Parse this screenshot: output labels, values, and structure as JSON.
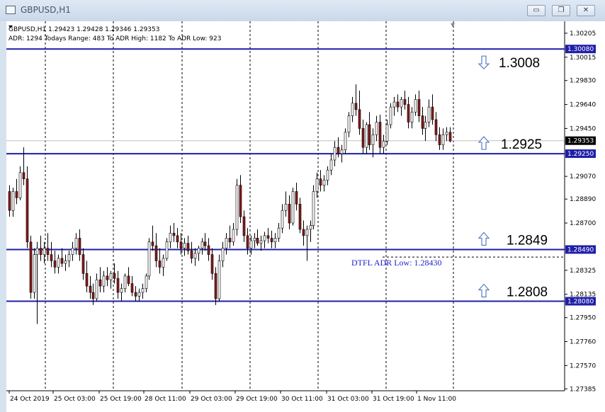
{
  "window": {
    "title": "GBPUSD,H1",
    "minimize_glyph": "▭",
    "restore_glyph": "❐",
    "close_glyph": "✕"
  },
  "chart_data": {
    "type": "candlestick",
    "symbol_line": "GBPUSD,H1  1.29423 1.29428 1.29346 1.29353",
    "info_line": "ADR: 1294  Todays Range: 483   To ADR High: 1182   To ADR Low: 923",
    "current_price": "1.29353",
    "ylim": [
      1.2737,
      1.303
    ],
    "y_ticks": [
      "1.30205",
      "1.30015",
      "1.29830",
      "1.29640",
      "1.29450",
      "1.29070",
      "1.28890",
      "1.28700",
      "1.28325",
      "1.28135",
      "1.27950",
      "1.27760",
      "1.27570",
      "1.27385"
    ],
    "x_labels": [
      "24 Oct 2019",
      "25 Oct 03:00",
      "25 Oct 19:00",
      "28 Oct 11:00",
      "29 Oct 03:00",
      "29 Oct 19:00",
      "30 Oct 11:00",
      "31 Oct 03:00",
      "31 Oct 19:00",
      "1 Nov 11:00"
    ],
    "levels": [
      {
        "price": 1.3008,
        "tag": "1.30080",
        "label": "1.3008",
        "arrow": "down"
      },
      {
        "price": 1.2925,
        "tag": "1.29250",
        "label": "1.2925",
        "arrow": "up"
      },
      {
        "price": 1.2849,
        "tag": "1.28490",
        "label": "1.2849",
        "arrow": "up"
      },
      {
        "price": 1.2808,
        "tag": "1.28080",
        "label": "1.2808",
        "arrow": "up"
      }
    ],
    "adr_low": {
      "price": 1.2843,
      "text": "DTFL ADR Low: 1.28430"
    },
    "candles": [
      [
        1.2895,
        1.29,
        1.2875,
        1.288
      ],
      [
        1.288,
        1.2898,
        1.2875,
        1.2895
      ],
      [
        1.2895,
        1.2905,
        1.2885,
        1.289
      ],
      [
        1.289,
        1.2915,
        1.2888,
        1.291
      ],
      [
        1.291,
        1.293,
        1.29,
        1.2905
      ],
      [
        1.2905,
        1.2915,
        1.285,
        1.2855
      ],
      [
        1.2855,
        1.286,
        1.281,
        1.2815
      ],
      [
        1.2815,
        1.285,
        1.281,
        1.2845
      ],
      [
        1.2845,
        1.2855,
        1.279,
        1.285
      ],
      [
        1.285,
        1.286,
        1.284,
        1.2845
      ],
      [
        1.2845,
        1.2855,
        1.2838,
        1.285
      ],
      [
        1.285,
        1.2862,
        1.284,
        1.2845
      ],
      [
        1.2845,
        1.2855,
        1.2835,
        1.284
      ],
      [
        1.284,
        1.2848,
        1.283,
        1.2835
      ],
      [
        1.2835,
        1.2845,
        1.283,
        1.2842
      ],
      [
        1.2842,
        1.285,
        1.2835,
        1.2838
      ],
      [
        1.2838,
        1.2845,
        1.2832,
        1.284
      ],
      [
        1.284,
        1.2848,
        1.2835,
        1.2845
      ],
      [
        1.2845,
        1.2855,
        1.284,
        1.285
      ],
      [
        1.285,
        1.2862,
        1.2845,
        1.2858
      ],
      [
        1.2858,
        1.2865,
        1.284,
        1.2845
      ],
      [
        1.2845,
        1.285,
        1.2825,
        1.283
      ],
      [
        1.283,
        1.284,
        1.2815,
        1.282
      ],
      [
        1.282,
        1.2828,
        1.281,
        1.2815
      ],
      [
        1.2815,
        1.2822,
        1.2805,
        1.281
      ],
      [
        1.281,
        1.283,
        1.2808,
        1.2825
      ],
      [
        1.2825,
        1.2835,
        1.2815,
        1.282
      ],
      [
        1.282,
        1.2832,
        1.2815,
        1.2828
      ],
      [
        1.2828,
        1.2835,
        1.282,
        1.2825
      ],
      [
        1.2825,
        1.2832,
        1.2818,
        1.283
      ],
      [
        1.283,
        1.2838,
        1.2822,
        1.2826
      ],
      [
        1.2826,
        1.2832,
        1.281,
        1.2815
      ],
      [
        1.2815,
        1.2822,
        1.2808,
        1.2818
      ],
      [
        1.2818,
        1.283,
        1.2815,
        1.2828
      ],
      [
        1.2828,
        1.2835,
        1.282,
        1.2822
      ],
      [
        1.2822,
        1.2828,
        1.2812,
        1.2815
      ],
      [
        1.2815,
        1.282,
        1.2808,
        1.2812
      ],
      [
        1.2812,
        1.2818,
        1.2808,
        1.2815
      ],
      [
        1.2815,
        1.2822,
        1.281,
        1.2818
      ],
      [
        1.2818,
        1.283,
        1.2815,
        1.2828
      ],
      [
        1.2828,
        1.2858,
        1.2825,
        1.2855
      ],
      [
        1.2855,
        1.2868,
        1.2848,
        1.2852
      ],
      [
        1.2852,
        1.2862,
        1.2835,
        1.284
      ],
      [
        1.284,
        1.285,
        1.283,
        1.2835
      ],
      [
        1.2835,
        1.2845,
        1.2828,
        1.2842
      ],
      [
        1.2842,
        1.2858,
        1.284,
        1.2855
      ],
      [
        1.2855,
        1.2868,
        1.285,
        1.2862
      ],
      [
        1.2862,
        1.287,
        1.2855,
        1.286
      ],
      [
        1.286,
        1.2866,
        1.285,
        1.2855
      ],
      [
        1.2855,
        1.2862,
        1.2845,
        1.285
      ],
      [
        1.285,
        1.2858,
        1.2844,
        1.2854
      ],
      [
        1.2854,
        1.286,
        1.2845,
        1.2848
      ],
      [
        1.2848,
        1.2855,
        1.2838,
        1.2842
      ],
      [
        1.2842,
        1.285,
        1.2836,
        1.2846
      ],
      [
        1.2846,
        1.2852,
        1.284,
        1.285
      ],
      [
        1.285,
        1.2858,
        1.2845,
        1.2855
      ],
      [
        1.2855,
        1.2862,
        1.2848,
        1.2852
      ],
      [
        1.2852,
        1.2858,
        1.284,
        1.2845
      ],
      [
        1.2845,
        1.285,
        1.2825,
        1.283
      ],
      [
        1.283,
        1.2835,
        1.2805,
        1.281
      ],
      [
        1.281,
        1.2845,
        1.2808,
        1.284
      ],
      [
        1.284,
        1.2855,
        1.2835,
        1.285
      ],
      [
        1.285,
        1.2862,
        1.2845,
        1.2858
      ],
      [
        1.2858,
        1.2868,
        1.285,
        1.2855
      ],
      [
        1.2855,
        1.287,
        1.2852,
        1.2865
      ],
      [
        1.2865,
        1.2905,
        1.286,
        1.29
      ],
      [
        1.29,
        1.2908,
        1.287,
        1.2875
      ],
      [
        1.2875,
        1.288,
        1.2855,
        1.286
      ],
      [
        1.286,
        1.2866,
        1.2845,
        1.285
      ],
      [
        1.285,
        1.286,
        1.2845,
        1.2856
      ],
      [
        1.2856,
        1.2862,
        1.285,
        1.2858
      ],
      [
        1.2858,
        1.2865,
        1.2852,
        1.2854
      ],
      [
        1.2854,
        1.286,
        1.2848,
        1.2856
      ],
      [
        1.2856,
        1.2863,
        1.285,
        1.286
      ],
      [
        1.286,
        1.2866,
        1.2854,
        1.2858
      ],
      [
        1.2858,
        1.2864,
        1.285,
        1.2855
      ],
      [
        1.2855,
        1.2862,
        1.285,
        1.2858
      ],
      [
        1.2858,
        1.287,
        1.2855,
        1.2866
      ],
      [
        1.2866,
        1.2885,
        1.2862,
        1.288
      ],
      [
        1.288,
        1.2895,
        1.2875,
        1.2885
      ],
      [
        1.2885,
        1.2892,
        1.2865,
        1.287
      ],
      [
        1.287,
        1.2898,
        1.2868,
        1.2895
      ],
      [
        1.2895,
        1.2902,
        1.288,
        1.2885
      ],
      [
        1.2885,
        1.289,
        1.2862,
        1.2865
      ],
      [
        1.2865,
        1.2872,
        1.2852,
        1.286
      ],
      [
        1.286,
        1.2868,
        1.284,
        1.2865
      ],
      [
        1.2865,
        1.2872,
        1.2855,
        1.2868
      ],
      [
        1.2868,
        1.29,
        1.2865,
        1.2895
      ],
      [
        1.2895,
        1.291,
        1.289,
        1.2905
      ],
      [
        1.2905,
        1.2912,
        1.2895,
        1.29
      ],
      [
        1.29,
        1.2908,
        1.2895,
        1.2904
      ],
      [
        1.2904,
        1.2915,
        1.29,
        1.2912
      ],
      [
        1.2912,
        1.2925,
        1.2908,
        1.292
      ],
      [
        1.292,
        1.2935,
        1.2915,
        1.293
      ],
      [
        1.293,
        1.2938,
        1.2922,
        1.2925
      ],
      [
        1.2925,
        1.2932,
        1.2918,
        1.2928
      ],
      [
        1.2928,
        1.2945,
        1.2925,
        1.2942
      ],
      [
        1.2942,
        1.2958,
        1.2938,
        1.2955
      ],
      [
        1.2955,
        1.297,
        1.295,
        1.2965
      ],
      [
        1.2965,
        1.298,
        1.2955,
        1.296
      ],
      [
        1.296,
        1.2975,
        1.294,
        1.2945
      ],
      [
        1.2945,
        1.2952,
        1.2925,
        1.293
      ],
      [
        1.293,
        1.295,
        1.2925,
        1.2948
      ],
      [
        1.2948,
        1.2958,
        1.2928,
        1.2932
      ],
      [
        1.2932,
        1.2945,
        1.2922,
        1.294
      ],
      [
        1.294,
        1.2955,
        1.2935,
        1.295
      ],
      [
        1.295,
        1.2956,
        1.2925,
        1.293
      ],
      [
        1.293,
        1.294,
        1.2925,
        1.2935
      ],
      [
        1.2935,
        1.2952,
        1.2932,
        1.2948
      ],
      [
        1.2948,
        1.2965,
        1.2945,
        1.2962
      ],
      [
        1.2962,
        1.297,
        1.2955,
        1.2966
      ],
      [
        1.2966,
        1.2972,
        1.2958,
        1.2962
      ],
      [
        1.2962,
        1.297,
        1.2955,
        1.2968
      ],
      [
        1.2968,
        1.2975,
        1.296,
        1.2964
      ],
      [
        1.2964,
        1.297,
        1.2945,
        1.295
      ],
      [
        1.295,
        1.2962,
        1.2945,
        1.2958
      ],
      [
        1.2958,
        1.2972,
        1.2955,
        1.2968
      ],
      [
        1.2968,
        1.2975,
        1.295,
        1.2955
      ],
      [
        1.2955,
        1.2962,
        1.294,
        1.2945
      ],
      [
        1.2945,
        1.2955,
        1.2935,
        1.295
      ],
      [
        1.295,
        1.2968,
        1.2946,
        1.2962
      ],
      [
        1.2962,
        1.2972,
        1.2948,
        1.2952
      ],
      [
        1.2952,
        1.2958,
        1.2935,
        1.294
      ],
      [
        1.294,
        1.2946,
        1.2928,
        1.2932
      ],
      [
        1.2932,
        1.2945,
        1.2928,
        1.294
      ],
      [
        1.294,
        1.2946,
        1.2935,
        1.2942
      ],
      [
        1.2942,
        1.2946,
        1.2934,
        1.2935
      ]
    ]
  }
}
